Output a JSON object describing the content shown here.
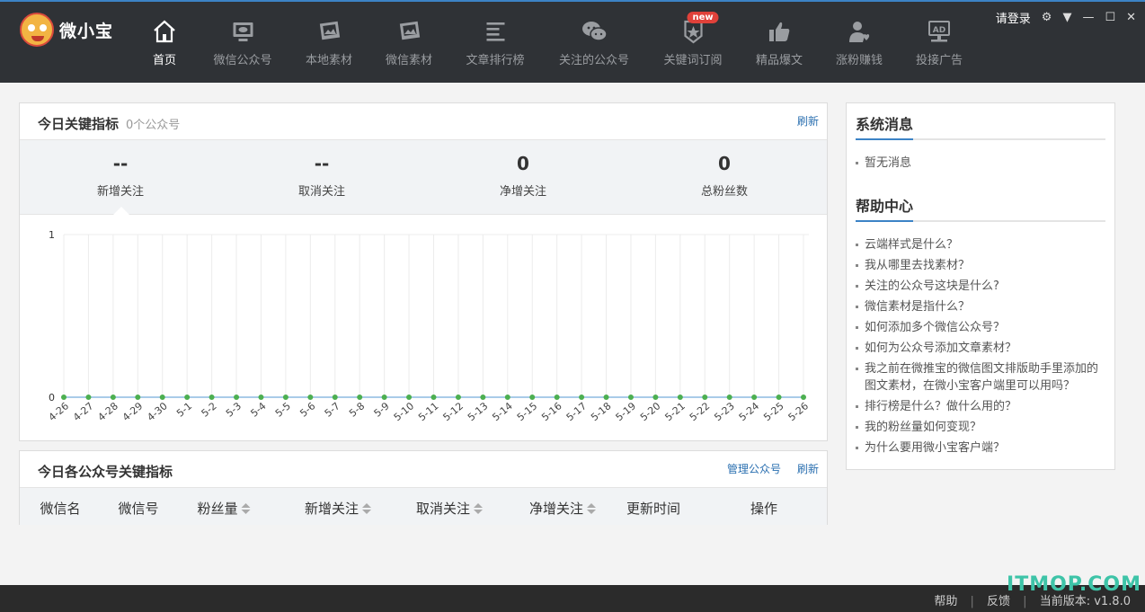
{
  "app": {
    "logo_text": "微小宝",
    "login_label": "请登录"
  },
  "nav": [
    {
      "label": "首页",
      "icon": "home-icon",
      "active": true
    },
    {
      "label": "微信公众号",
      "icon": "monitor-icon"
    },
    {
      "label": "本地素材",
      "icon": "picture-icon"
    },
    {
      "label": "微信素材",
      "icon": "picture-icon"
    },
    {
      "label": "文章排行榜",
      "icon": "list-icon"
    },
    {
      "label": "关注的公众号",
      "icon": "wechat-icon"
    },
    {
      "label": "关键词订阅",
      "icon": "badge-star-icon",
      "badge": "new"
    },
    {
      "label": "精品爆文",
      "icon": "thumbs-up-icon"
    },
    {
      "label": "涨粉赚钱",
      "icon": "user-heart-icon"
    },
    {
      "label": "投接广告",
      "icon": "ad-icon"
    }
  ],
  "metrics": {
    "title": "今日关键指标",
    "subtitle": "0个公众号",
    "refresh_label": "刷新",
    "kpis": [
      {
        "value": "--",
        "label": "新增关注"
      },
      {
        "value": "--",
        "label": "取消关注"
      },
      {
        "value": "0",
        "label": "净增关注"
      },
      {
        "value": "0",
        "label": "总粉丝数"
      }
    ]
  },
  "chart_data": {
    "type": "line",
    "title": "",
    "xlabel": "",
    "ylabel": "",
    "ylim": [
      0,
      1
    ],
    "yticks": [
      "0",
      "1"
    ],
    "grid": true,
    "color": "#4caf50",
    "categories": [
      "4-26",
      "4-27",
      "4-28",
      "4-29",
      "4-30",
      "5-1",
      "5-2",
      "5-3",
      "5-4",
      "5-5",
      "5-6",
      "5-7",
      "5-8",
      "5-9",
      "5-10",
      "5-11",
      "5-12",
      "5-13",
      "5-14",
      "5-15",
      "5-16",
      "5-17",
      "5-18",
      "5-19",
      "5-20",
      "5-21",
      "5-22",
      "5-23",
      "5-24",
      "5-25",
      "5-26"
    ],
    "series": [
      {
        "values": [
          0,
          0,
          0,
          0,
          0,
          0,
          0,
          0,
          0,
          0,
          0,
          0,
          0,
          0,
          0,
          0,
          0,
          0,
          0,
          0,
          0,
          0,
          0,
          0,
          0,
          0,
          0,
          0,
          0,
          0,
          0
        ]
      }
    ]
  },
  "accounts": {
    "title": "今日各公众号关键指标",
    "manage_label": "管理公众号",
    "refresh_label": "刷新",
    "columns": [
      {
        "label": "微信名",
        "sortable": false
      },
      {
        "label": "微信号",
        "sortable": false
      },
      {
        "label": "粉丝量",
        "sortable": true
      },
      {
        "label": "新增关注",
        "sortable": true
      },
      {
        "label": "取消关注",
        "sortable": true
      },
      {
        "label": "净增关注",
        "sortable": true
      },
      {
        "label": "更新时间",
        "sortable": false
      },
      {
        "label": "操作",
        "sortable": false
      }
    ]
  },
  "side": {
    "system_title": "系统消息",
    "system_items": [
      "暂无消息"
    ],
    "help_title": "帮助中心",
    "help_items": [
      "云端样式是什么？",
      "我从哪里去找素材？",
      "关注的公众号这块是什么?",
      "微信素材是指什么？",
      "如何添加多个微信公众号？",
      "如何为公众号添加文章素材？",
      "我之前在微推宝的微信图文排版助手里添加的图文素材，在微小宝客户端里可以用吗？",
      "排行榜是什么？做什么用的？",
      "我的粉丝量如何变现？",
      "为什么要用微小宝客户端？"
    ]
  },
  "footer": {
    "help": "帮助",
    "feedback": "反馈",
    "version": "当前版本: v1.8.0",
    "watermark": "ITMOP.COM"
  }
}
